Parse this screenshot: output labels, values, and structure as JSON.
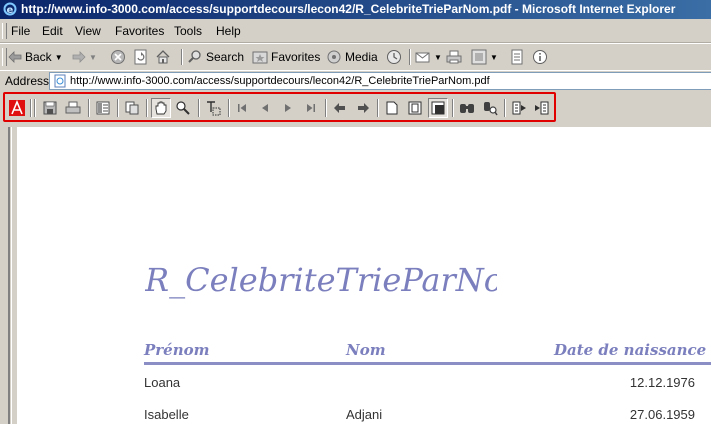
{
  "window": {
    "title": "http://www.info-3000.com/access/supportdecours/lecon42/R_CelebriteTrieParNom.pdf - Microsoft Internet Explorer"
  },
  "menu": {
    "items": [
      "File",
      "Edit",
      "View",
      "Favorites",
      "Tools",
      "Help"
    ]
  },
  "toolbar": {
    "back_label": "Back",
    "search_label": "Search",
    "favorites_label": "Favorites",
    "media_label": "Media"
  },
  "address": {
    "label": "Address",
    "url": "http://www.info-3000.com/access/supportdecours/lecon42/R_CelebriteTrieParNom.pdf"
  },
  "acrobat_toolbar": {
    "highlight_color": "#e00000",
    "tools": [
      "adobe-logo-icon",
      "save-icon",
      "print-icon",
      "bookmarks-icon",
      "thumbnails-icon",
      "hand-tool-icon",
      "zoom-tool-icon",
      "text-select-icon",
      "first-page-icon",
      "previous-page-icon",
      "next-page-icon",
      "last-page-icon",
      "go-back-icon",
      "go-forward-icon",
      "actual-size-icon",
      "fit-page-icon",
      "fit-width-icon",
      "find-icon",
      "search-icon",
      "ebook-icon",
      "reflow-icon"
    ]
  },
  "report": {
    "title": "R_CelebriteTrieParNom",
    "accent_color": "#7b7fbd",
    "columns": [
      "Prénom",
      "Nom",
      "Date de naissance"
    ],
    "rows": [
      [
        "Loana",
        "",
        "12.12.1976"
      ],
      [
        "Isabelle",
        "Adjani",
        "27.06.1959"
      ]
    ]
  }
}
